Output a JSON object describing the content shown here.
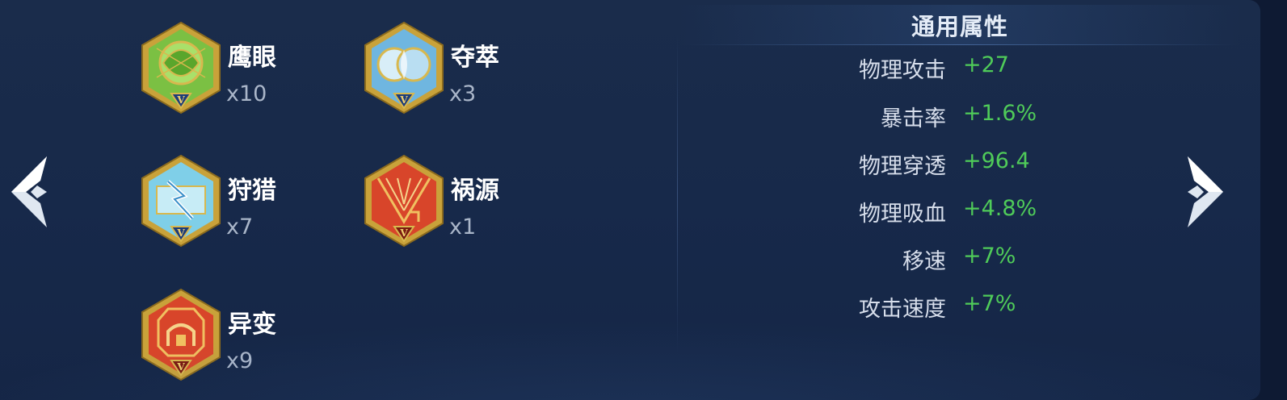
{
  "runes": [
    {
      "name": "鹰眼",
      "count": "x10",
      "icon": "eagle-eye-rune-icon",
      "color": "#7bc043"
    },
    {
      "name": "夺萃",
      "count": "x3",
      "icon": "seize-rune-icon",
      "color": "#6fb6e0"
    },
    {
      "name": "狩猎",
      "count": "x7",
      "icon": "hunt-rune-icon",
      "color": "#7fcfe8"
    },
    {
      "name": "祸源",
      "count": "x1",
      "icon": "calamity-rune-icon",
      "color": "#d8452a"
    },
    {
      "name": "异变",
      "count": "x9",
      "icon": "mutation-rune-icon",
      "color": "#d8452a"
    }
  ],
  "rune_level_mark": "V",
  "stats": {
    "title": "通用属性",
    "items": [
      {
        "name": "物理攻击",
        "value": "+27"
      },
      {
        "name": "暴击率",
        "value": "+1.6%"
      },
      {
        "name": "物理穿透",
        "value": "+96.4"
      },
      {
        "name": "物理吸血",
        "value": "+4.8%"
      },
      {
        "name": "移速",
        "value": "+7%"
      },
      {
        "name": "攻击速度",
        "value": "+7%"
      }
    ]
  },
  "nav": {
    "prev_icon": "chevron-left-icon",
    "next_icon": "chevron-right-icon"
  },
  "colors": {
    "value_green": "#4fcb59",
    "gold_frame": "#c9a23a",
    "panel_bg": "#1a2c4b"
  }
}
